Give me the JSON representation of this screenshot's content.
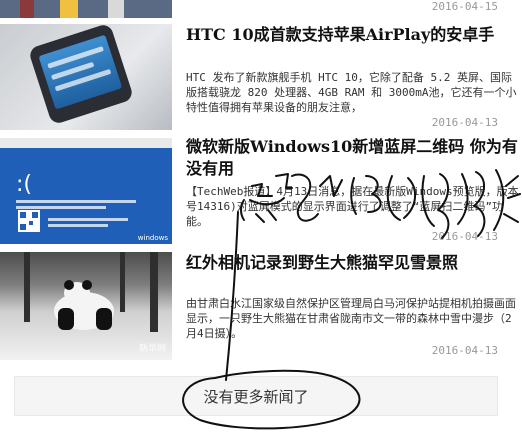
{
  "top_item": {
    "date": "2016-04-15"
  },
  "articles": [
    {
      "title": "HTC 10成首款支持苹果AirPlay的安卓手",
      "summary": "HTC 发布了新款旗舰手机 HTC 10，它除了配备 5.2 英屏、国际版搭载骁龙 820 处理器、4GB RAM 和 3000mA池，它还有一个小特性值得拥有苹果设备的朋友注意，",
      "date": "2016-04-13"
    },
    {
      "title": "微软新版Windows10新增蓝屏二维码 你为有没有用",
      "summary": "【TechWeb报道】4月13日消息，据在最新版Windows预览版，版本号14316)对蓝屏模式的显示界面进行了调整了“蓝屏扫二维码”功能。",
      "date": "2016-04-13",
      "thumb_face": ":(",
      "thumb_caption": "windows"
    },
    {
      "title": "红外相机记录到野生大熊猫罕见雪景照",
      "summary": "由甘肃白水江国家级自然保护区管理局白马河保护站提相机拍摄画面显示，一只野生大熊猫在甘肃省陇南市文一带的森林中雪中漫步（2月4日摄）。",
      "date": "2016-04-13",
      "watermark": "新华网"
    }
  ],
  "footer": {
    "label": "没有更多新闻了"
  }
}
